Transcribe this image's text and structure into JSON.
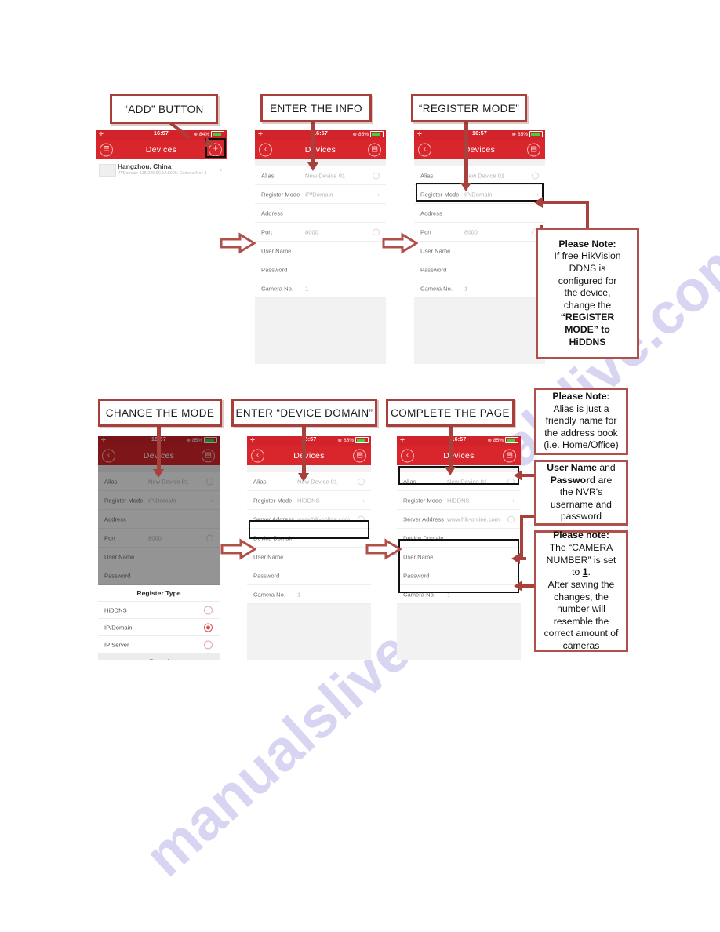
{
  "watermark": {
    "text": "manualslive.com"
  },
  "callouts": {
    "add_button": "“ADD” BUTTON",
    "enter_info": "ENTER THE INFO",
    "register_mode": "“REGISTER MODE”",
    "change_mode": "CHANGE THE MODE",
    "enter_device_domain": "ENTER “DEVICE DOMAIN”",
    "complete_page": "COMPLETE THE PAGE"
  },
  "notes": {
    "ddns": {
      "l1": "Please Note:",
      "l2": "If free HikVision",
      "l3": "DDNS is",
      "l4": "configured for",
      "l5": "the device,",
      "l6": "change the",
      "l7": "“REGISTER",
      "l8": "MODE” to",
      "l9": "HiDDNS"
    },
    "alias": {
      "l1": "Please Note:",
      "l2": "Alias is just a",
      "l3": "friendly name for",
      "l4": "the address book",
      "l5": "(i.e. Home/Office)"
    },
    "credentials": {
      "l1": "User Name",
      "l2": "and",
      "l3": "Password",
      "l4": "are",
      "l5": "the NVR's",
      "l6": "username and",
      "l7": "password"
    },
    "camera_number": {
      "l1": "Please note:",
      "l2": "The “CAMERA",
      "l3": "NUMBER” is set",
      "l4": "to",
      "l5": "1",
      "l6": ".",
      "l7": "After saving the",
      "l8": "changes, the",
      "l9": "number will",
      "l10": "resemble the",
      "l11": "correct amount of",
      "l12": "cameras"
    }
  },
  "phones": {
    "p1": {
      "status": {
        "time": "16:57",
        "battery": "84%"
      },
      "navtitle": "Devices",
      "menu_icon": "hamburger-icon",
      "add_icon": "plus-icon",
      "device": {
        "title": "Hangzhou, China",
        "subtitle": "IP/Domain: 115.235.50.53:8000, Camera No.: 1"
      }
    },
    "p2": {
      "status": {
        "time": "16:57",
        "battery": "85%"
      },
      "navtitle": "Devices",
      "fields": [
        {
          "label": "Alias",
          "value": "New Device 01",
          "acc": "clear"
        },
        {
          "label": "Register Mode",
          "value": "IP/Domain",
          "acc": "chev"
        },
        {
          "label": "Address",
          "value": "",
          "acc": ""
        },
        {
          "label": "Port",
          "value": "8000",
          "acc": "clear"
        },
        {
          "label": "User Name",
          "value": "",
          "acc": ""
        },
        {
          "label": "Password",
          "value": "",
          "acc": ""
        },
        {
          "label": "Camera No.",
          "value": "1",
          "acc": ""
        }
      ]
    },
    "p3": {
      "status": {
        "time": "16:57",
        "battery": "85%"
      },
      "navtitle": "Devices",
      "fields": [
        {
          "label": "Alias",
          "value": "New Device 01",
          "acc": "clear"
        },
        {
          "label": "Register Mode",
          "value": "IP/Domain",
          "acc": "chev"
        },
        {
          "label": "Address",
          "value": "",
          "acc": ""
        },
        {
          "label": "Port",
          "value": "8000",
          "acc": "clear"
        },
        {
          "label": "User Name",
          "value": "",
          "acc": ""
        },
        {
          "label": "Password",
          "value": "",
          "acc": ""
        },
        {
          "label": "Camera No.",
          "value": "1",
          "acc": ""
        }
      ]
    },
    "p4": {
      "status": {
        "time": "16:57",
        "battery": "85%"
      },
      "navtitle": "Devices",
      "fields": [
        {
          "label": "Alias",
          "value": "New Device 01",
          "acc": "clear"
        },
        {
          "label": "Register Mode",
          "value": "IP/Domain",
          "acc": "chev"
        },
        {
          "label": "Address",
          "value": "",
          "acc": ""
        },
        {
          "label": "Port",
          "value": "8000",
          "acc": "clear"
        },
        {
          "label": "User Name",
          "value": "",
          "acc": ""
        },
        {
          "label": "Password",
          "value": "",
          "acc": ""
        }
      ],
      "sheet": {
        "title": "Register Type",
        "options": [
          {
            "label": "HiDDNS",
            "selected": false
          },
          {
            "label": "IP/Domain",
            "selected": true
          },
          {
            "label": "IP Server",
            "selected": false
          }
        ],
        "cancel": "Cancel"
      }
    },
    "p5": {
      "status": {
        "time": "16:57",
        "battery": "85%"
      },
      "navtitle": "Devices",
      "fields": [
        {
          "label": "Alias",
          "value": "New Device 01",
          "acc": "clear"
        },
        {
          "label": "Register Mode",
          "value": "HiDDNS",
          "acc": "chev"
        },
        {
          "label": "Server Address",
          "value": "www.hik-online.com",
          "acc": "clear"
        },
        {
          "label": "Device Domain",
          "value": "",
          "acc": ""
        },
        {
          "label": "User Name",
          "value": "",
          "acc": ""
        },
        {
          "label": "Password",
          "value": "",
          "acc": ""
        },
        {
          "label": "Camera No.",
          "value": "1",
          "acc": ""
        }
      ]
    },
    "p6": {
      "status": {
        "time": "16:57",
        "battery": "85%"
      },
      "navtitle": "Devices",
      "fields": [
        {
          "label": "Alias",
          "value": "New Device 01",
          "acc": "clear"
        },
        {
          "label": "Register Mode",
          "value": "HiDDNS",
          "acc": "chev"
        },
        {
          "label": "Server Address",
          "value": "www.hik-online.com",
          "acc": "clear"
        },
        {
          "label": "Device Domain",
          "value": "",
          "acc": ""
        },
        {
          "label": "User Name",
          "value": "",
          "acc": ""
        },
        {
          "label": "Password",
          "value": "",
          "acc": ""
        },
        {
          "label": "Camera No.",
          "value": "1",
          "acc": ""
        }
      ]
    }
  }
}
